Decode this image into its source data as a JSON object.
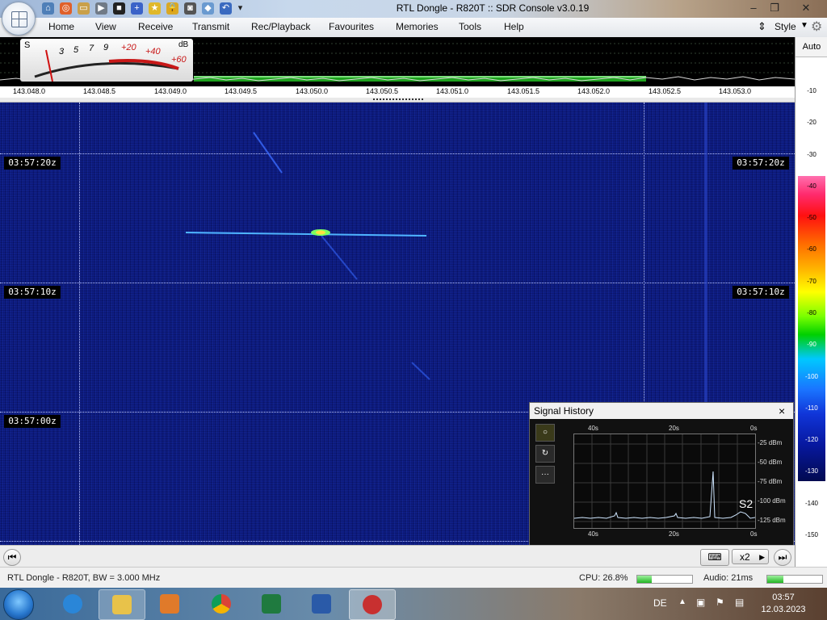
{
  "window": {
    "title": "RTL Dongle - R820T :: SDR Console v3.0.19"
  },
  "menu": {
    "items": [
      "Home",
      "View",
      "Receive",
      "Transmit",
      "Rec/Playback",
      "Favourites",
      "Memories",
      "Tools",
      "Help"
    ],
    "style_label": "Style"
  },
  "smeter": {
    "labels": [
      "S",
      "3",
      "5",
      "7",
      "9",
      "+20",
      "+40",
      "+60"
    ],
    "unit": "dB"
  },
  "frequency_scale": [
    "143.048.0",
    "143.048.5",
    "143.049.0",
    "143.049.5",
    "143.050.0",
    "143.050.5",
    "143.051.0",
    "143.051.5",
    "143.052.0",
    "143.052.5",
    "143.053.0"
  ],
  "waterfall": {
    "time_labels": [
      "03:57:20z",
      "03:57:10z",
      "03:57:00z"
    ]
  },
  "db_scale": {
    "auto_label": "Auto",
    "ticks": [
      "-10",
      "-20",
      "-30",
      "-40",
      "-50",
      "-60",
      "-70",
      "-80",
      "-90",
      "-100",
      "-110",
      "-120",
      "-130",
      "-140",
      "-150"
    ]
  },
  "signal_history": {
    "title": "Signal History",
    "close": "×",
    "time_labels_top": [
      "40s",
      "20s",
      "0s"
    ],
    "time_labels_bottom": [
      "40s",
      "20s",
      "0s"
    ],
    "level_labels": [
      "-25 dBm",
      "-50 dBm",
      "-75 dBm",
      "-100 dBm",
      "-125 dBm"
    ],
    "s_reading": "S2",
    "more_button": "···"
  },
  "controls": {
    "zoom_label": "x2"
  },
  "status": {
    "device": "RTL Dongle - R820T, BW = 3.000 MHz",
    "cpu": "CPU: 26.8%",
    "cpu_level": 0.268,
    "audio": "Audio: 21ms",
    "audio_level": 0.3
  },
  "taskbar": {
    "language": "DE",
    "time": "03:57",
    "date": "12.03.2023"
  }
}
